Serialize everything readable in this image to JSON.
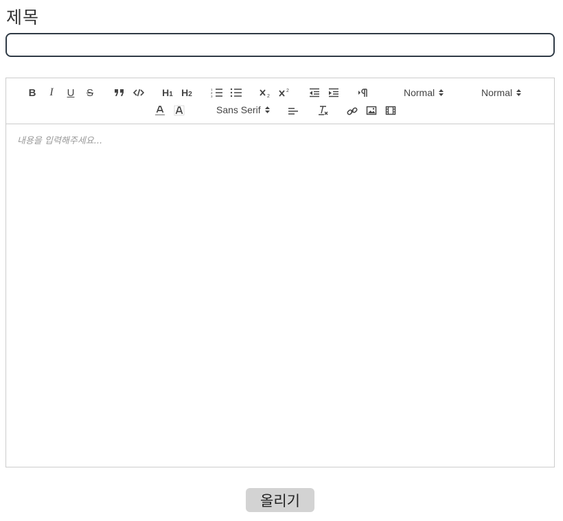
{
  "form": {
    "title_label": "제목",
    "title_value": "",
    "submit_label": "올리기"
  },
  "editor": {
    "placeholder": "내용을 입력해주세요...",
    "toolbar": {
      "bold": "B",
      "italic": "I",
      "underline": "U",
      "strike": "S",
      "header1": "H",
      "header1_sub": "1",
      "header2": "H",
      "header2_sub": "2",
      "size_picker": "Normal",
      "header_picker": "Normal",
      "font_picker": "Sans Serif"
    },
    "icons": [
      "blockquote-icon",
      "code-block-icon",
      "ordered-list-icon",
      "bullet-list-icon",
      "subscript-icon",
      "superscript-icon",
      "outdent-icon",
      "indent-icon",
      "text-direction-icon",
      "text-color-icon",
      "background-color-icon",
      "align-left-icon",
      "clear-format-icon",
      "link-icon",
      "image-icon",
      "video-icon"
    ]
  },
  "colors": {
    "input_border": "#2f3a45",
    "editor_border": "#cccccc",
    "button_bg": "#d3d3d3",
    "placeholder": "#999999"
  }
}
